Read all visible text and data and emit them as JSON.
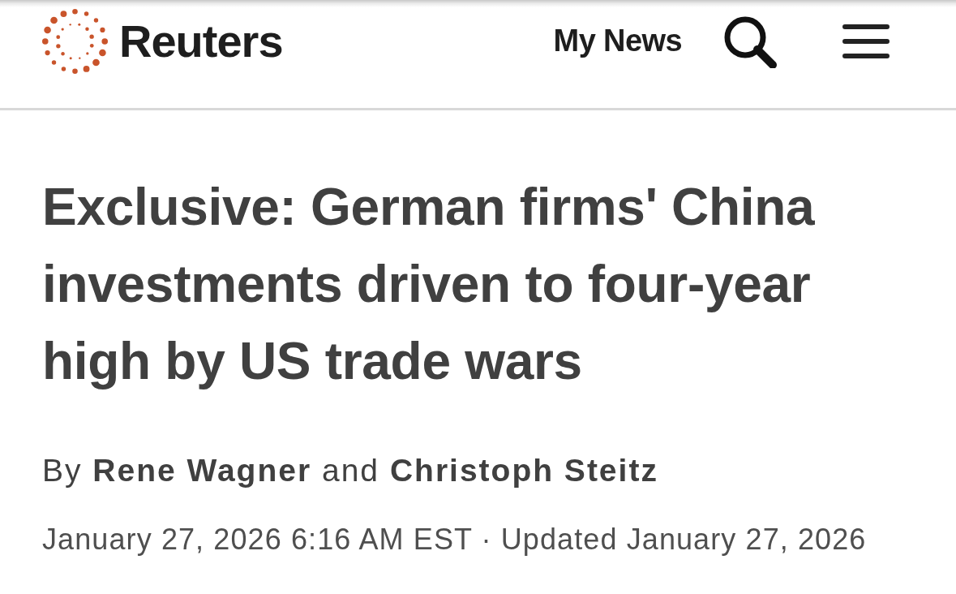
{
  "header": {
    "logo_text": "Reuters",
    "nav_link": "My News"
  },
  "article": {
    "headline": "Exclusive: German firms' China investments driven to four-year high by US trade wars",
    "byline": "By **Rene Wagner** and **Christoph Steitz**",
    "dateline": "January 27, 2026 6:16 AM EST · Updated January 27, 2026"
  }
}
